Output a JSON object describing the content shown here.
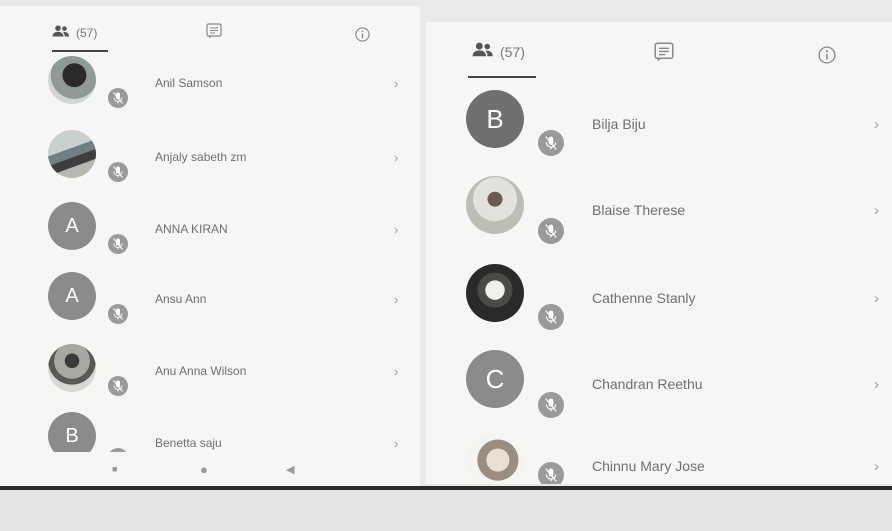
{
  "left_panel": {
    "tabs": {
      "participants_count": "(57)"
    },
    "participants": [
      {
        "name": "Anil Samson",
        "avatar_letter": ""
      },
      {
        "name": "Anjaly sabeth zm",
        "avatar_letter": ""
      },
      {
        "name": "ANNA KIRAN",
        "avatar_letter": "A"
      },
      {
        "name": "Ansu Ann",
        "avatar_letter": "A"
      },
      {
        "name": "Anu Anna Wilson",
        "avatar_letter": ""
      },
      {
        "name": "Benetta saju",
        "avatar_letter": "B"
      }
    ],
    "chevron": "›",
    "nav": {
      "recents": "■",
      "home": "●",
      "back": "◀"
    }
  },
  "right_panel": {
    "tabs": {
      "participants_count": "(57)"
    },
    "participants": [
      {
        "name": "Bilja Biju",
        "avatar_letter": "B"
      },
      {
        "name": "Blaise Therese",
        "avatar_letter": ""
      },
      {
        "name": "Cathenne Stanly",
        "avatar_letter": ""
      },
      {
        "name": "Chandran Reethu",
        "avatar_letter": "C"
      },
      {
        "name": "Chinnu Mary Jose",
        "avatar_letter": ""
      }
    ],
    "chevron": "›"
  },
  "icons": {
    "people": "people-icon",
    "chat": "chat-icon",
    "info": "info-icon",
    "mic_off": "mic-off-icon"
  },
  "colors": {
    "avatar_gray": "#8b8b8b",
    "mic_gray": "#9a9a9a",
    "tab_underline": "#444444"
  }
}
